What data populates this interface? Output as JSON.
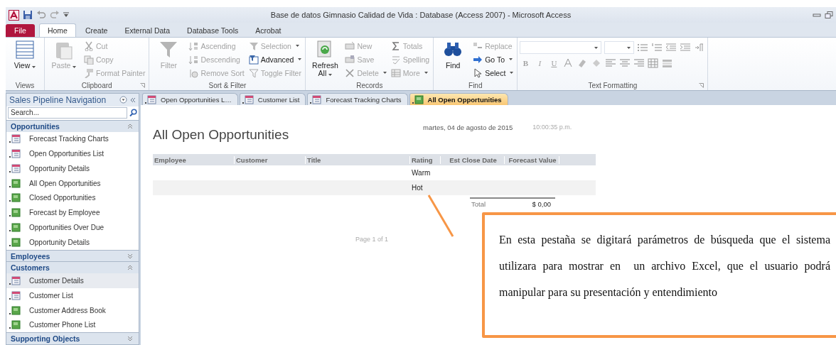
{
  "window": {
    "title": "Base de datos Gimnasio Calidad de Vida : Database (Access 2007)  -  Microsoft Access"
  },
  "ribbon_tabs": [
    {
      "label": "File",
      "kind": "file",
      "selected": false
    },
    {
      "label": "Home",
      "kind": "tab",
      "selected": true
    },
    {
      "label": "Create",
      "kind": "tab",
      "selected": false
    },
    {
      "label": "External Data",
      "kind": "tab",
      "selected": false
    },
    {
      "label": "Database Tools",
      "kind": "tab",
      "selected": false
    },
    {
      "label": "Acrobat",
      "kind": "tab",
      "selected": false
    }
  ],
  "ribbon_groups": [
    {
      "label": "Views",
      "kind": "commands",
      "launcher": false,
      "commands": [
        {
          "label": "View",
          "kind": "large",
          "disabled": false,
          "dropdown": true
        }
      ]
    },
    {
      "label": "Clipboard",
      "kind": "commands",
      "launcher": true,
      "commands": [
        {
          "label": "Paste",
          "kind": "large",
          "disabled": true,
          "dropdown": true
        },
        {
          "label": "Cut",
          "kind": "small",
          "disabled": true,
          "dropdown": false
        },
        {
          "label": "Copy",
          "kind": "small",
          "disabled": true,
          "dropdown": false
        },
        {
          "label": "Format Painter",
          "kind": "small",
          "disabled": true,
          "dropdown": false
        }
      ]
    },
    {
      "label": "Sort & Filter",
      "kind": "commands",
      "launcher": false,
      "commands": [
        {
          "label": "Filter",
          "kind": "large",
          "disabled": true,
          "dropdown": false
        },
        {
          "label": "Ascending",
          "kind": "small",
          "disabled": true,
          "dropdown": false
        },
        {
          "label": "Descending",
          "kind": "small",
          "disabled": true,
          "dropdown": false
        },
        {
          "label": "Remove Sort",
          "kind": "small",
          "disabled": true,
          "dropdown": false
        },
        {
          "label": "Selection",
          "kind": "small",
          "disabled": true,
          "dropdown": true
        },
        {
          "label": "Advanced",
          "kind": "small",
          "disabled": false,
          "dropdown": true
        },
        {
          "label": "Toggle Filter",
          "kind": "small",
          "disabled": true,
          "dropdown": false
        }
      ]
    },
    {
      "label": "Records",
      "kind": "commands",
      "launcher": false,
      "commands": [
        {
          "label": "Refresh All",
          "kind": "large",
          "disabled": false,
          "dropdown": true
        },
        {
          "label": "New",
          "kind": "small",
          "disabled": true,
          "dropdown": false
        },
        {
          "label": "Save",
          "kind": "small",
          "disabled": true,
          "dropdown": false
        },
        {
          "label": "Delete",
          "kind": "small",
          "disabled": true,
          "dropdown": true
        },
        {
          "label": "Totals",
          "kind": "small",
          "disabled": true,
          "dropdown": false
        },
        {
          "label": "Spelling",
          "kind": "small",
          "disabled": true,
          "dropdown": false
        },
        {
          "label": "More",
          "kind": "small",
          "disabled": true,
          "dropdown": true
        }
      ]
    },
    {
      "label": "Find",
      "kind": "commands",
      "launcher": false,
      "commands": [
        {
          "label": "Find",
          "kind": "large",
          "disabled": false,
          "dropdown": false
        },
        {
          "label": "Replace",
          "kind": "small",
          "disabled": true,
          "dropdown": false
        },
        {
          "label": "Go To",
          "kind": "small",
          "disabled": false,
          "dropdown": true
        },
        {
          "label": "Select",
          "kind": "small",
          "disabled": false,
          "dropdown": true
        }
      ]
    },
    {
      "label": "Text Formatting",
      "kind": "text_formatting",
      "launcher": true,
      "buttons": [
        {
          "label": "B",
          "disabled": true
        },
        {
          "label": "I",
          "disabled": true
        },
        {
          "label": "U",
          "disabled": true
        }
      ]
    }
  ],
  "nav": {
    "title": "Sales Pipeline Navigation",
    "search": {
      "placeholder": "Search..."
    },
    "groups": [
      {
        "label": "Opportunities",
        "expanded": true,
        "items": [
          {
            "label": "Forecast Tracking Charts",
            "kind": "form",
            "selected": false
          },
          {
            "label": "Open Opportunities List",
            "kind": "form",
            "selected": false
          },
          {
            "label": "Opportunity Details",
            "kind": "form",
            "selected": false
          },
          {
            "label": "All Open Opportunities",
            "kind": "report",
            "selected": false
          },
          {
            "label": "Closed Opportunities",
            "kind": "report",
            "selected": false
          },
          {
            "label": "Forecast by Employee",
            "kind": "report",
            "selected": false
          },
          {
            "label": "Opportunities Over Due",
            "kind": "report",
            "selected": false
          },
          {
            "label": "Opportunity Details",
            "kind": "report",
            "selected": false
          }
        ]
      },
      {
        "label": "Employees",
        "expanded": false
      },
      {
        "label": "Customers",
        "expanded": true,
        "items": [
          {
            "label": "Customer Details",
            "kind": "form",
            "selected": true
          },
          {
            "label": "Customer List",
            "kind": "form",
            "selected": false
          },
          {
            "label": "Customer Address Book",
            "kind": "report",
            "selected": false
          },
          {
            "label": "Customer Phone List",
            "kind": "report",
            "selected": false
          }
        ]
      },
      {
        "label": "Supporting Objects",
        "expanded": false
      }
    ]
  },
  "doc_tabs": [
    {
      "label": "Open Opportunities L…",
      "kind": "form",
      "selected": false
    },
    {
      "label": "Customer List",
      "kind": "form",
      "selected": false
    },
    {
      "label": "Forecast Tracking Charts",
      "kind": "form",
      "selected": false
    },
    {
      "label": "All Open Opportunities",
      "kind": "report",
      "selected": true
    }
  ],
  "report": {
    "title": "All Open Opportunities",
    "date": "martes, 04 de agosto de 2015",
    "time": "10:00:35 p.m.",
    "columns": [
      "Employee",
      "Customer",
      "Title",
      "Rating",
      "Est Close Date",
      "Forecast Value"
    ],
    "rows": [
      {
        "rating": "Warm"
      },
      {
        "rating": "Hot"
      }
    ],
    "total": {
      "label": "Total",
      "value": "$ 0,00"
    },
    "page": "Page 1 of 1"
  },
  "callout": {
    "text": "En esta pestaña se digitará parámetros de búsqueda que el sistema utilizara para mostrar en  un archivo Excel, que el usuario podrá manipular para su presentación y entendimiento"
  }
}
